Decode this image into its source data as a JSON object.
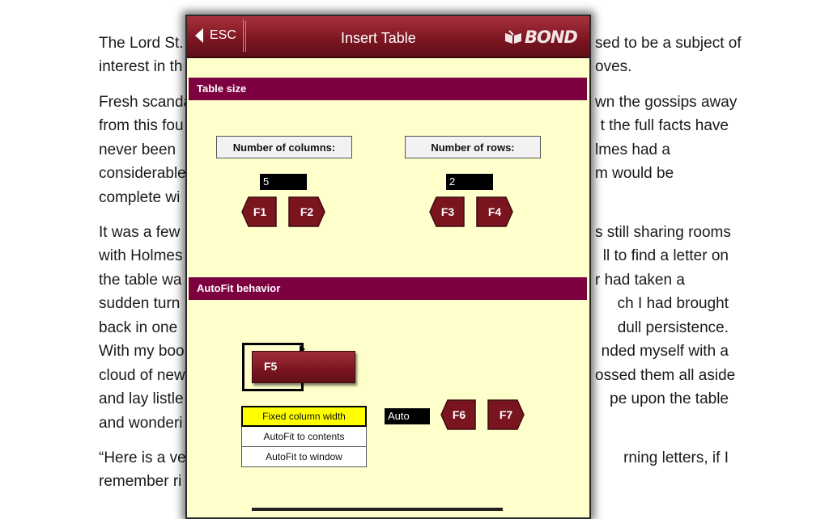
{
  "document": {
    "lines": [
      {
        "left": "The Lord St.",
        "right": "sed to be a subject of"
      },
      {
        "left": "interest in th",
        "right": "oves."
      },
      {
        "left": "Fresh scanda",
        "right": "wn the gossips away"
      },
      {
        "left": "from this fou",
        "right": "t the full facts have"
      },
      {
        "left": "never been",
        "right": "lmes had a"
      },
      {
        "left": "considerable",
        "right": "m would be"
      },
      {
        "left": "complete wi",
        "right": ""
      },
      {
        "left": "It was a few",
        "right": "s still sharing rooms"
      },
      {
        "left": "with Holmes",
        "right": "ll to find a letter on"
      },
      {
        "left": "the table wa",
        "right": "r had taken a"
      },
      {
        "left": "sudden turn",
        "right": "ch I had brought"
      },
      {
        "left": "back in one",
        "right": "dull persistence."
      },
      {
        "left": "With my boo",
        "right": "nded myself with a"
      },
      {
        "left": "cloud of new",
        "right": "ossed them all aside"
      },
      {
        "left": "and lay listle",
        "right": "pe upon the table"
      },
      {
        "left": "and wonderi",
        "right": ""
      },
      {
        "left": "“Here is a ve",
        "right": "rning letters, if I"
      },
      {
        "left": "remember ri",
        "right": ""
      }
    ]
  },
  "dialog": {
    "title": "Insert Table",
    "esc_label": "ESC",
    "logo_text": "BOND",
    "colors": {
      "titlebar": "#7e1622",
      "section": "#7d0040",
      "background": "#ffffcc",
      "selected": "#ffff00"
    },
    "table_size": {
      "header": "Table size",
      "columns_label": "Number of columns:",
      "columns_value": "5",
      "rows_label": "Number of rows:",
      "rows_value": "2",
      "keys": [
        "F1",
        "F2",
        "F3",
        "F4"
      ]
    },
    "autofit": {
      "header": "AutoFit behavior",
      "f5_label": "F5",
      "mode_value": "Auto",
      "keys": [
        "F6",
        "F7"
      ],
      "options": [
        "Fixed column width",
        "AutoFit to contents",
        "AutoFit to window"
      ],
      "selected_option": "Fixed column width"
    }
  }
}
